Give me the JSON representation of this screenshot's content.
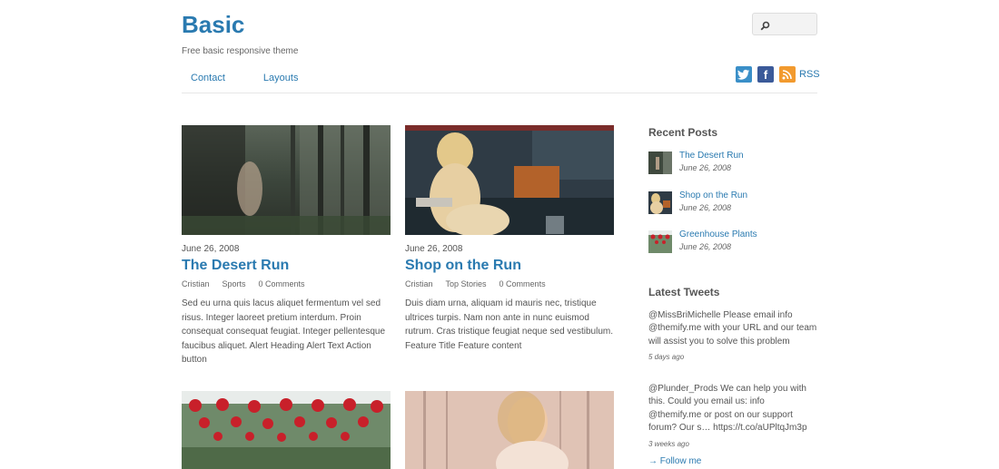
{
  "site": {
    "title": "Basic",
    "description": "Free basic responsive theme",
    "search_placeholder": ""
  },
  "nav": {
    "items": [
      "Contact",
      "Layouts"
    ]
  },
  "social": {
    "rss_label": "RSS",
    "icons": [
      "twitter-icon",
      "facebook-icon",
      "rss-icon"
    ]
  },
  "posts": [
    {
      "date": "June 26, 2008",
      "title": "The Desert Run",
      "author": "Cristian",
      "category": "Sports",
      "comments": "0 Comments",
      "excerpt": "Sed eu urna quis lacus aliquet fermentum vel sed risus. Integer laoreet pretium interdum. Proin consequat consequat feugiat. Integer pellentesque faucibus aliquet. Alert Heading Alert Text Action button"
    },
    {
      "date": "June 26, 2008",
      "title": "Shop on the Run",
      "author": "Cristian",
      "category": "Top Stories",
      "comments": "0 Comments",
      "excerpt": "Duis diam urna, aliquam id mauris nec, tristique ultrices turpis. Nam non ante in nunc euismod rutrum. Cras tristique feugiat neque sed vestibulum. Feature Title Feature content"
    }
  ],
  "recent_posts": {
    "title": "Recent Posts",
    "items": [
      {
        "title": "The Desert Run",
        "date": "June 26, 2008"
      },
      {
        "title": "Shop on the Run",
        "date": "June 26, 2008"
      },
      {
        "title": "Greenhouse Plants",
        "date": "June 26, 2008"
      }
    ]
  },
  "tweets": {
    "title": "Latest Tweets",
    "items": [
      {
        "text": "@MissBriMichelle Please email info @themify.me with your URL and our team will assist you to solve this problem",
        "time": "5 days ago"
      },
      {
        "text": "@Plunder_Prods We can help you with this. Could you email us: info @themify.me or post on our support forum? Our s… https://t.co/aUPltqJm3p",
        "time": "3 weeks ago"
      }
    ],
    "follow": "→ Follow me"
  },
  "colors": {
    "link": "#2a7ab0",
    "text": "#555555",
    "divider": "#e6e6e6"
  }
}
